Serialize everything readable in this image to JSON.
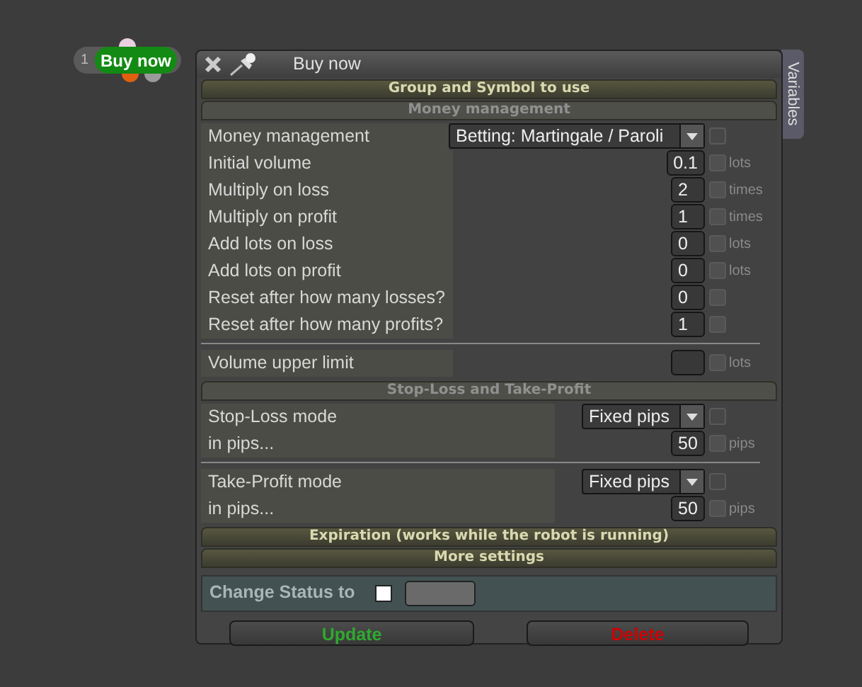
{
  "node": {
    "number": "1",
    "label": "Buy now",
    "dots": [
      {
        "color": "#e8d0e0"
      },
      {
        "color": "#e06010"
      },
      {
        "color": "#9a9a9a"
      }
    ]
  },
  "window": {
    "title": "Buy now",
    "side_tab": "Variables"
  },
  "sections": [
    {
      "title": "Group and Symbol to use",
      "kind": "main"
    },
    {
      "title": "Money management",
      "kind": "sub",
      "blocks": [
        [
          {
            "kind": "select",
            "label": "Money management",
            "value": "Betting: Martingale / Paroli",
            "checked": false
          },
          {
            "kind": "number",
            "label": "Initial volume",
            "value": "0.1",
            "checked": false,
            "unit": "lots"
          },
          {
            "kind": "number",
            "label": "Multiply on loss",
            "value": "2",
            "checked": false,
            "unit": "times"
          },
          {
            "kind": "number",
            "label": "Multiply on profit",
            "value": "1",
            "checked": false,
            "unit": "times"
          },
          {
            "kind": "number",
            "label": "Add lots on loss",
            "value": "0",
            "checked": false,
            "unit": "lots"
          },
          {
            "kind": "number",
            "label": "Add lots on profit",
            "value": "0",
            "checked": false,
            "unit": "lots"
          },
          {
            "kind": "number",
            "label": "Reset after how many losses?",
            "value": "0",
            "checked": false
          },
          {
            "kind": "number",
            "label": "Reset after how many profits?",
            "value": "1",
            "checked": false
          }
        ],
        [
          {
            "kind": "number",
            "label": "Volume upper limit",
            "checked": false,
            "unit": "lots"
          }
        ]
      ]
    },
    {
      "title": "Stop-Loss and Take-Profit",
      "kind": "sub",
      "narrow": true,
      "blocks": [
        [
          {
            "kind": "select",
            "label": "Stop-Loss mode",
            "value": "Fixed pips",
            "checked": false
          },
          {
            "kind": "number",
            "label": "in pips...",
            "value": "50",
            "checked": false,
            "unit": "pips"
          }
        ],
        [
          {
            "kind": "select",
            "label": "Take-Profit mode",
            "value": "Fixed pips",
            "checked": false
          },
          {
            "kind": "number",
            "label": "in pips...",
            "value": "50",
            "checked": false,
            "unit": "pips"
          }
        ]
      ]
    },
    {
      "title": "Expiration (works while the robot is running)",
      "kind": "main"
    },
    {
      "title": "More settings",
      "kind": "main"
    }
  ],
  "status": {
    "label": "Change Status to",
    "checked": false
  },
  "buttons": [
    {
      "label": "Update",
      "color": "#2eaa2e"
    },
    {
      "label": "Delete",
      "color": "#d00000"
    }
  ]
}
